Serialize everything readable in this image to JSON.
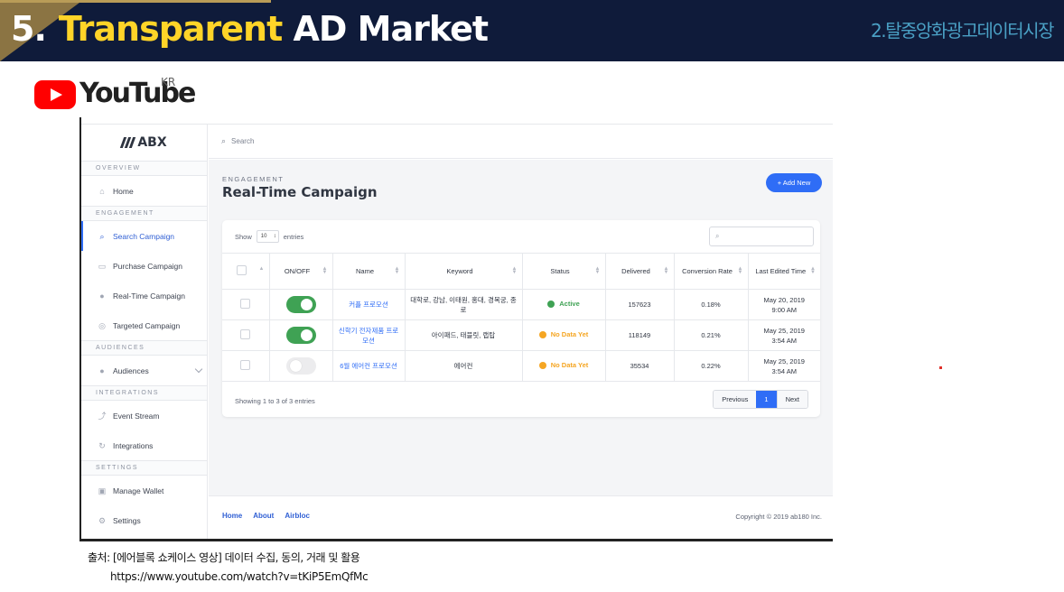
{
  "slide": {
    "number": "5.",
    "title_highlight": "Transparent",
    "title_rest": "AD Market",
    "subtitle": "2.탈중앙화광고데이터시장",
    "youtube_word": "YouTube",
    "youtube_region": "KR",
    "source": "출처: [에어블록 쇼케이스 영상] 데이터 수집, 동의, 거래 및 활용",
    "source_url": "https://www.youtube.com/watch?v=tKiP5EmQfMc"
  },
  "app": {
    "brand": "ABX",
    "search_placeholder": "Search",
    "sidebar": {
      "sections": {
        "overview": "OVERVIEW",
        "engagement": "ENGAGEMENT",
        "audiences": "AUDIENCES",
        "integrations": "INTEGRATIONS",
        "settings": "SETTINGS"
      },
      "items": {
        "home": "Home",
        "search_campaign": "Search Campaign",
        "purchase_campaign": "Purchase Campaign",
        "realtime_campaign": "Real-Time Campaign",
        "targeted_campaign": "Targeted Campaign",
        "audiences": "Audiences",
        "event_stream": "Event Stream",
        "integrations": "Integrations",
        "manage_wallet": "Manage Wallet",
        "settings": "Settings"
      }
    },
    "page": {
      "eyebrow": "ENGAGEMENT",
      "title": "Real-Time Campaign",
      "add_button": "+ Add New"
    },
    "table": {
      "show_label": "Show",
      "entries_value": "10",
      "entries_label": "entries",
      "columns": {
        "onoff": "ON/OFF",
        "name": "Name",
        "keyword": "Keyword",
        "status": "Status",
        "delivered": "Delivered",
        "conversion": "Conversion Rate",
        "last_edited": "Last Edited Time"
      },
      "rows": [
        {
          "enabled": true,
          "name": "커플 프로모션",
          "keyword": "대학로, 강남, 이태원, 홍대, 경복궁, 종로",
          "status": "Active",
          "status_color": "#3fa254",
          "delivered": "157623",
          "conversion": "0.18%",
          "date": "May 20, 2019",
          "time": "9:00 AM"
        },
        {
          "enabled": true,
          "name": "신학기 전자제품 프로모션",
          "keyword": "아이패드, 태블릿, 랩탑",
          "status": "No Data Yet",
          "status_color": "#f5a623",
          "delivered": "118149",
          "conversion": "0.21%",
          "date": "May 25, 2019",
          "time": "3:54 AM"
        },
        {
          "enabled": false,
          "name": "6월 에어컨 프로모션",
          "keyword": "에어컨",
          "status": "No Data Yet",
          "status_color": "#f5a623",
          "delivered": "35534",
          "conversion": "0.22%",
          "date": "May 25, 2019",
          "time": "3:54 AM"
        }
      ],
      "showing": "Showing 1 to 3 of 3 entries",
      "pagination": {
        "previous": "Previous",
        "current": "1",
        "next": "Next"
      }
    },
    "footer": {
      "links": {
        "home": "Home",
        "about": "About",
        "airbloc": "Airbloc"
      },
      "copyright": "Copyright © 2019 ab180 Inc."
    }
  },
  "colors": {
    "accent": "#2f6df6",
    "active": "#3fa254",
    "pending": "#f5a623",
    "header_bg": "#0f1b3a",
    "title_highlight": "#ffd428"
  }
}
